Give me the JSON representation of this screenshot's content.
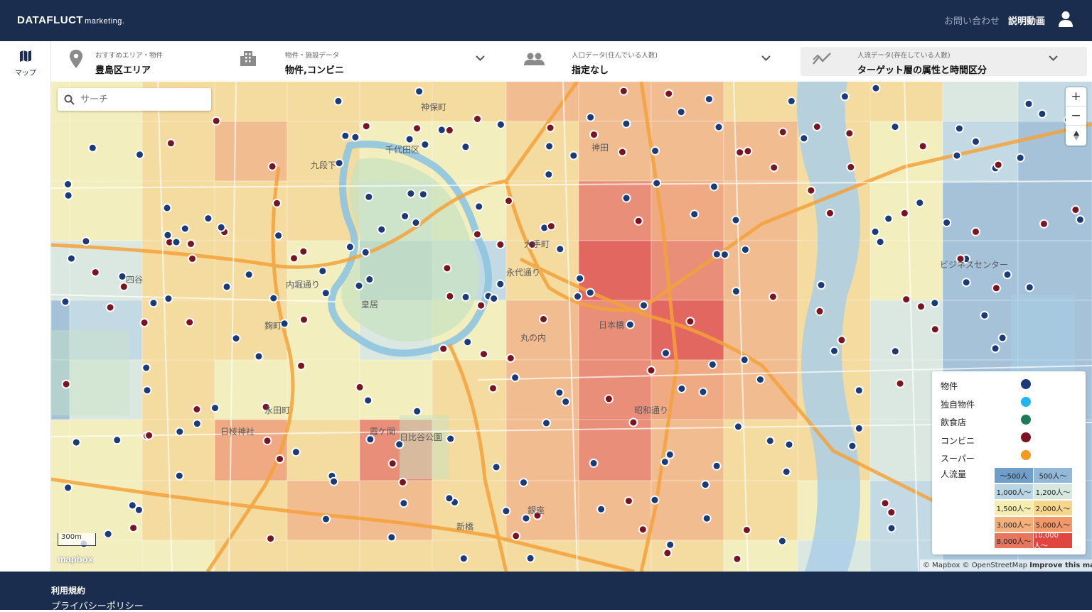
{
  "header": {
    "logo": "DATAFLUCT",
    "logo_sub": "marketing.",
    "contact": "お問い合わせ",
    "video": "説明動画"
  },
  "sidebar": {
    "map_label": "マップ"
  },
  "filters": [
    {
      "label": "おすすめエリア・物件",
      "value": "豊島区エリア",
      "icon": "pin-icon"
    },
    {
      "label": "物件・施設データ",
      "value": "物件,コンビニ",
      "icon": "building-icon"
    },
    {
      "label": "人口データ(住んでいる人数)",
      "value": "指定なし",
      "icon": "people-icon"
    },
    {
      "label": "人流データ(存在している人数)",
      "value": "ターゲット層の属性と時間区分",
      "icon": "flow-icon"
    }
  ],
  "search": {
    "placeholder": "サーチ"
  },
  "map_labels": [
    "千代田区",
    "皇居",
    "丸の内",
    "大手町",
    "日本橋",
    "神田",
    "永田町",
    "日枝神社",
    "霞ケ関",
    "日比谷公園",
    "銀座",
    "新橋",
    "ビジネスセンター",
    "永代通り",
    "昭和通り",
    "内堀通り",
    "四谷",
    "麹町",
    "九段下",
    "神保町"
  ],
  "legend": {
    "items": [
      {
        "label": "物件",
        "color": "#1a3a7a"
      },
      {
        "label": "独自物件",
        "color": "#1fb6f0"
      },
      {
        "label": "飲食店",
        "color": "#1f7a5a"
      },
      {
        "label": "コンビニ",
        "color": "#7a1420"
      },
      {
        "label": "スーパー",
        "color": "#f39a1e"
      }
    ],
    "flow_title": "人流量",
    "flow_levels": [
      {
        "label": "〜500人",
        "color": "#6f9ec8"
      },
      {
        "label": "500人〜",
        "color": "#93b7d6"
      },
      {
        "label": "1,000人〜",
        "color": "#b9d5e3"
      },
      {
        "label": "1,200人〜",
        "color": "#d6e7df"
      },
      {
        "label": "1,500人〜",
        "color": "#f4eeb2"
      },
      {
        "label": "2,000人〜",
        "color": "#f6d68d"
      },
      {
        "label": "3,000人〜",
        "color": "#f3b07c"
      },
      {
        "label": "5,000人〜",
        "color": "#f0986a"
      },
      {
        "label": "8,000人〜",
        "color": "#e8765e"
      },
      {
        "label": "10,000人〜",
        "color": "#e0453f"
      }
    ]
  },
  "map": {
    "scale": "300m",
    "mapbox": "mapbox",
    "attribution": "© Mapbox © OpenStreetMap",
    "improve": "Improve this map"
  },
  "footer": {
    "terms": "利用規約",
    "privacy": "プライバシーポリシー"
  }
}
